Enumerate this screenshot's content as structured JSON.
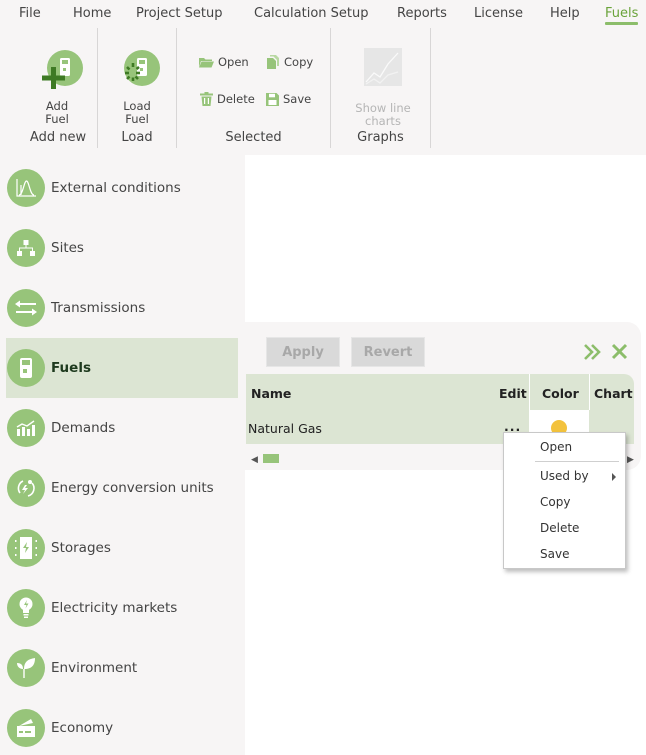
{
  "menu": {
    "items": [
      "File",
      "Home",
      "Project Setup",
      "Calculation Setup",
      "Reports",
      "License",
      "Help",
      "Fuels"
    ],
    "active": "Fuels"
  },
  "ribbon": {
    "groups": {
      "add_new": {
        "label": "Add new",
        "add_fuel": "Add\nFuel"
      },
      "load": {
        "label": "Load",
        "load_fuel": "Load\nFuel"
      },
      "selected": {
        "label": "Selected",
        "open": "Open",
        "copy": "Copy",
        "delete": "Delete",
        "save": "Save"
      },
      "graphs": {
        "label": "Graphs",
        "show_line_charts": "Show line\ncharts"
      }
    }
  },
  "sidebar": {
    "items": [
      {
        "label": "External conditions",
        "icon": "distribution-chart-icon"
      },
      {
        "label": "Sites",
        "icon": "hierarchy-icon"
      },
      {
        "label": "Transmissions",
        "icon": "transfer-arrows-icon"
      },
      {
        "label": "Fuels",
        "icon": "fuel-pump-icon",
        "active": true
      },
      {
        "label": "Demands",
        "icon": "bar-chart-trend-icon"
      },
      {
        "label": "Energy conversion units",
        "icon": "conversion-cycle-icon"
      },
      {
        "label": "Storages",
        "icon": "battery-storage-icon"
      },
      {
        "label": "Electricity markets",
        "icon": "lightbulb-icon"
      },
      {
        "label": "Environment",
        "icon": "leaf-icon"
      },
      {
        "label": "Economy",
        "icon": "wallet-icon"
      }
    ]
  },
  "panel": {
    "apply": "Apply",
    "revert": "Revert",
    "table": {
      "columns": [
        "Name",
        "Edit",
        "Color",
        "Chart"
      ],
      "rows": [
        {
          "name": "Natural Gas",
          "edit": "...",
          "color": "#f3c23d",
          "chart": ""
        }
      ]
    }
  },
  "context_menu": {
    "items": [
      "Open",
      "Used by",
      "Copy",
      "Delete",
      "Save"
    ]
  },
  "colors": {
    "accent": "#97c47a",
    "accent_dark": "#4e8a2a",
    "active_bg": "#dce5d3",
    "fuel_color": "#f3c23d"
  }
}
